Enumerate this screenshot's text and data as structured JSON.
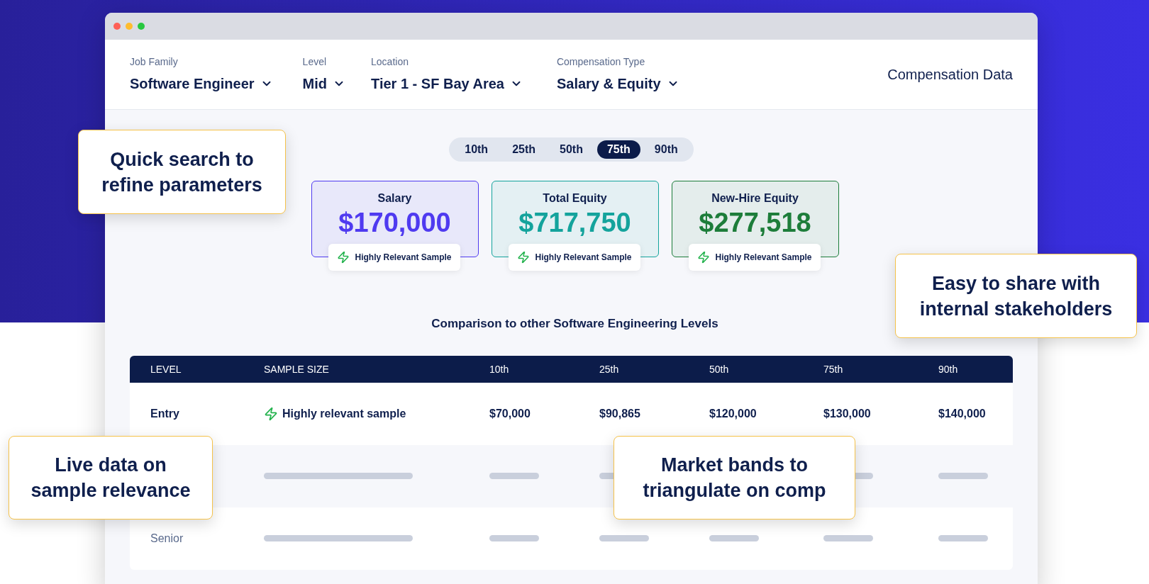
{
  "filters": [
    {
      "label": "Job Family",
      "value": "Software Engineer"
    },
    {
      "label": "Level",
      "value": "Mid"
    },
    {
      "label": "Location",
      "value": "Tier 1 - SF Bay Area"
    },
    {
      "label": "Compensation Type",
      "value": "Salary & Equity"
    }
  ],
  "header_title": "Compensation Data",
  "percentiles": [
    {
      "label": "10th",
      "selected": false
    },
    {
      "label": "25th",
      "selected": false
    },
    {
      "label": "50th",
      "selected": false
    },
    {
      "label": "75th",
      "selected": true
    },
    {
      "label": "90th",
      "selected": false
    }
  ],
  "cards": [
    {
      "title": "Salary",
      "amount": "$170,000",
      "color": "#4f3af0",
      "badge": "Highly Relevant Sample"
    },
    {
      "title": "Total Equity",
      "amount": "$717,750",
      "color": "#14a39c",
      "badge": "Highly Relevant Sample"
    },
    {
      "title": "New-Hire Equity",
      "amount": "$277,518",
      "color": "#1d7d3a",
      "badge": "Highly Relevant Sample"
    }
  ],
  "comparison": {
    "title": "Comparison to other Software Engineering Levels",
    "columns": [
      "LEVEL",
      "SAMPLE SIZE",
      "10th",
      "25th",
      "50th",
      "75th",
      "90th"
    ],
    "rows": [
      {
        "kind": "data",
        "level": "Entry",
        "sample": "Highly relevant sample",
        "values": [
          "$70,000",
          "$90,865",
          "$120,000",
          "$130,000",
          "$140,000"
        ]
      },
      {
        "kind": "placeholder",
        "bars": [
          true,
          true,
          true,
          false,
          true,
          true
        ]
      },
      {
        "kind": "placeholder",
        "level": "Senior",
        "bars": [
          true,
          true,
          true,
          true,
          true,
          true
        ]
      }
    ]
  },
  "callouts": [
    {
      "lines": [
        "Quick search to",
        "refine parameters"
      ]
    },
    {
      "lines": [
        "Easy to share with",
        "internal stakeholders"
      ]
    },
    {
      "lines": [
        "Live data on",
        "sample relevance"
      ]
    },
    {
      "lines": [
        "Market bands to",
        "triangulate on comp"
      ]
    }
  ]
}
